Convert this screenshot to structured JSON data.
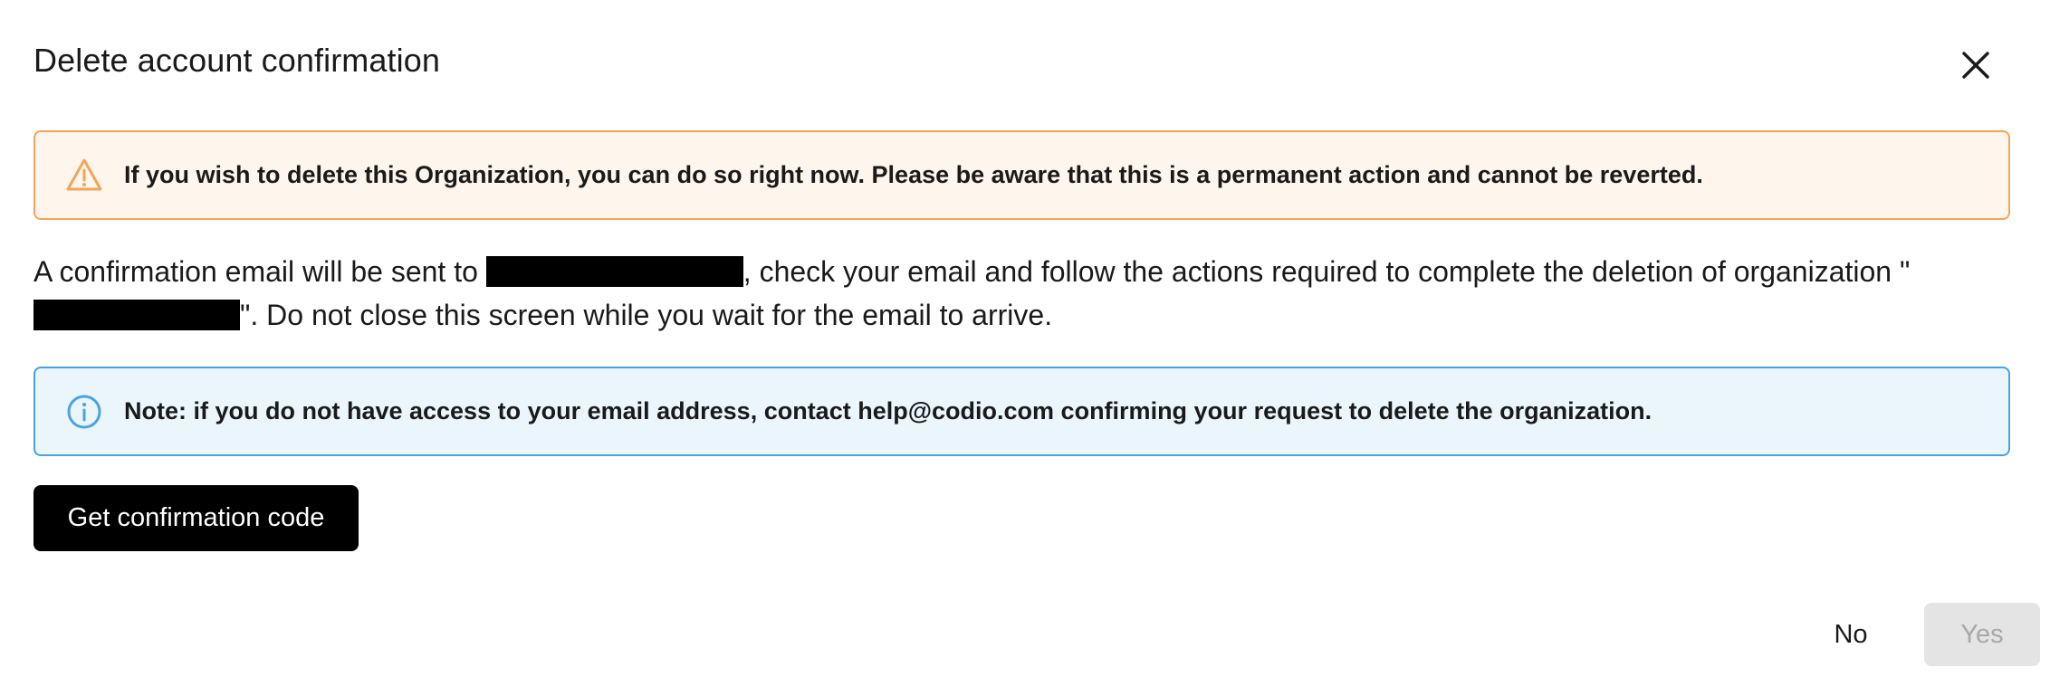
{
  "dialog": {
    "title": "Delete account confirmation",
    "close_icon": "close-icon"
  },
  "warning": {
    "icon": "warning-triangle-icon",
    "color": "#f2a55b",
    "background": "#fef5ec",
    "text": "If you wish to delete this Organization, you can do so right now. Please be aware that this is a permanent action and cannot be reverted."
  },
  "body": {
    "part1": "A confirmation email will be sent to ",
    "part2": ", check your email and follow the actions required to complete the deletion of organization \"",
    "part3": "\". Do not close this screen while you wait for the email to arrive."
  },
  "info": {
    "icon": "info-circle-icon",
    "color": "#4aa3df",
    "background": "#eaf5fc",
    "text": "Note: if you do not have access to your email address, contact help@codio.com confirming your request to delete the organization."
  },
  "actions": {
    "get_code_label": "Get confirmation code",
    "no_label": "No",
    "yes_label": "Yes",
    "yes_disabled": true
  }
}
